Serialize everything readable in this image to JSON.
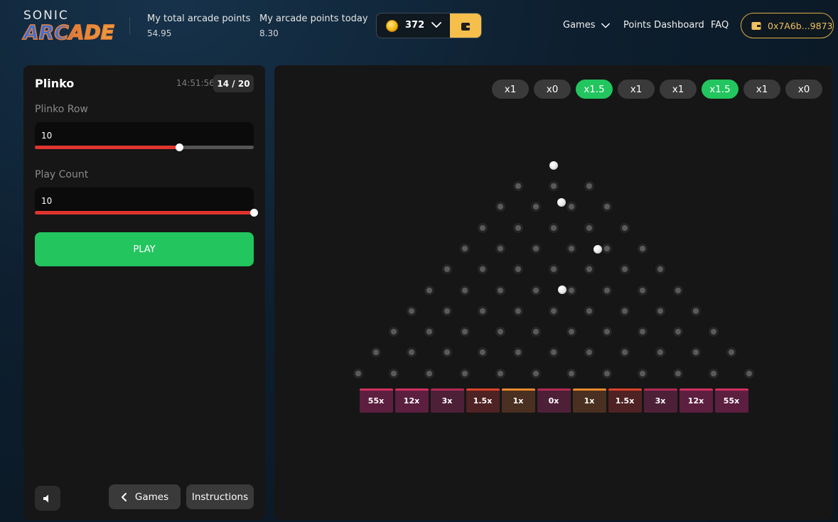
{
  "header": {
    "logo_top": "SONIC",
    "logo_bottom": "ARCADE",
    "total_points_label": "My total arcade points",
    "total_points_value": "54.95",
    "today_points_label": "My arcade points today",
    "today_points_value": "8.30",
    "coin_count": "372",
    "nav_games": "Games",
    "nav_dashboard": "Points Dashboard",
    "nav_faq": "FAQ",
    "wallet_address": "0x7A6b...9873"
  },
  "panel": {
    "title": "Plinko",
    "clock": "14:51:56",
    "round": "14 / 20",
    "row_label": "Plinko Row",
    "row_value": "10",
    "row_slider_fraction": 0.66,
    "count_label": "Play Count",
    "count_value": "10",
    "count_slider_fraction": 1.0,
    "play_label": "PLAY",
    "games_label": "Games",
    "instructions_label": "Instructions"
  },
  "board": {
    "history": [
      {
        "label": "x1",
        "win": false
      },
      {
        "label": "x0",
        "win": false
      },
      {
        "label": "x1.5",
        "win": true
      },
      {
        "label": "x1",
        "win": false
      },
      {
        "label": "x1",
        "win": false
      },
      {
        "label": "x1.5",
        "win": true
      },
      {
        "label": "x1",
        "win": false
      },
      {
        "label": "x0",
        "win": false
      }
    ],
    "rows": 10,
    "buckets": [
      {
        "label": "55x",
        "bg": "#5c1f3f",
        "top": "#d12f5e"
      },
      {
        "label": "12x",
        "bg": "#5c1f3f",
        "top": "#d12f5e"
      },
      {
        "label": "3x",
        "bg": "#4e2038",
        "top": "#b02a52"
      },
      {
        "label": "1.5x",
        "bg": "#4f2224",
        "top": "#d9432b"
      },
      {
        "label": "1x",
        "bg": "#4a3020",
        "top": "#e98a2c"
      },
      {
        "label": "0x",
        "bg": "#4e2038",
        "top": "#b02a52"
      },
      {
        "label": "1x",
        "bg": "#4a3020",
        "top": "#e98a2c"
      },
      {
        "label": "1.5x",
        "bg": "#4f2224",
        "top": "#d9432b"
      },
      {
        "label": "3x",
        "bg": "#4e2038",
        "top": "#b02a52"
      },
      {
        "label": "12x",
        "bg": "#5c1f3f",
        "top": "#d12f5e"
      },
      {
        "label": "55x",
        "bg": "#5c1f3f",
        "top": "#d12f5e"
      }
    ],
    "colors": {
      "win": "#22c55e",
      "neutral": "#3a3a3a",
      "play": "#22c55e",
      "slider": "#e0352e",
      "wallet": "#f6bf4c"
    }
  }
}
